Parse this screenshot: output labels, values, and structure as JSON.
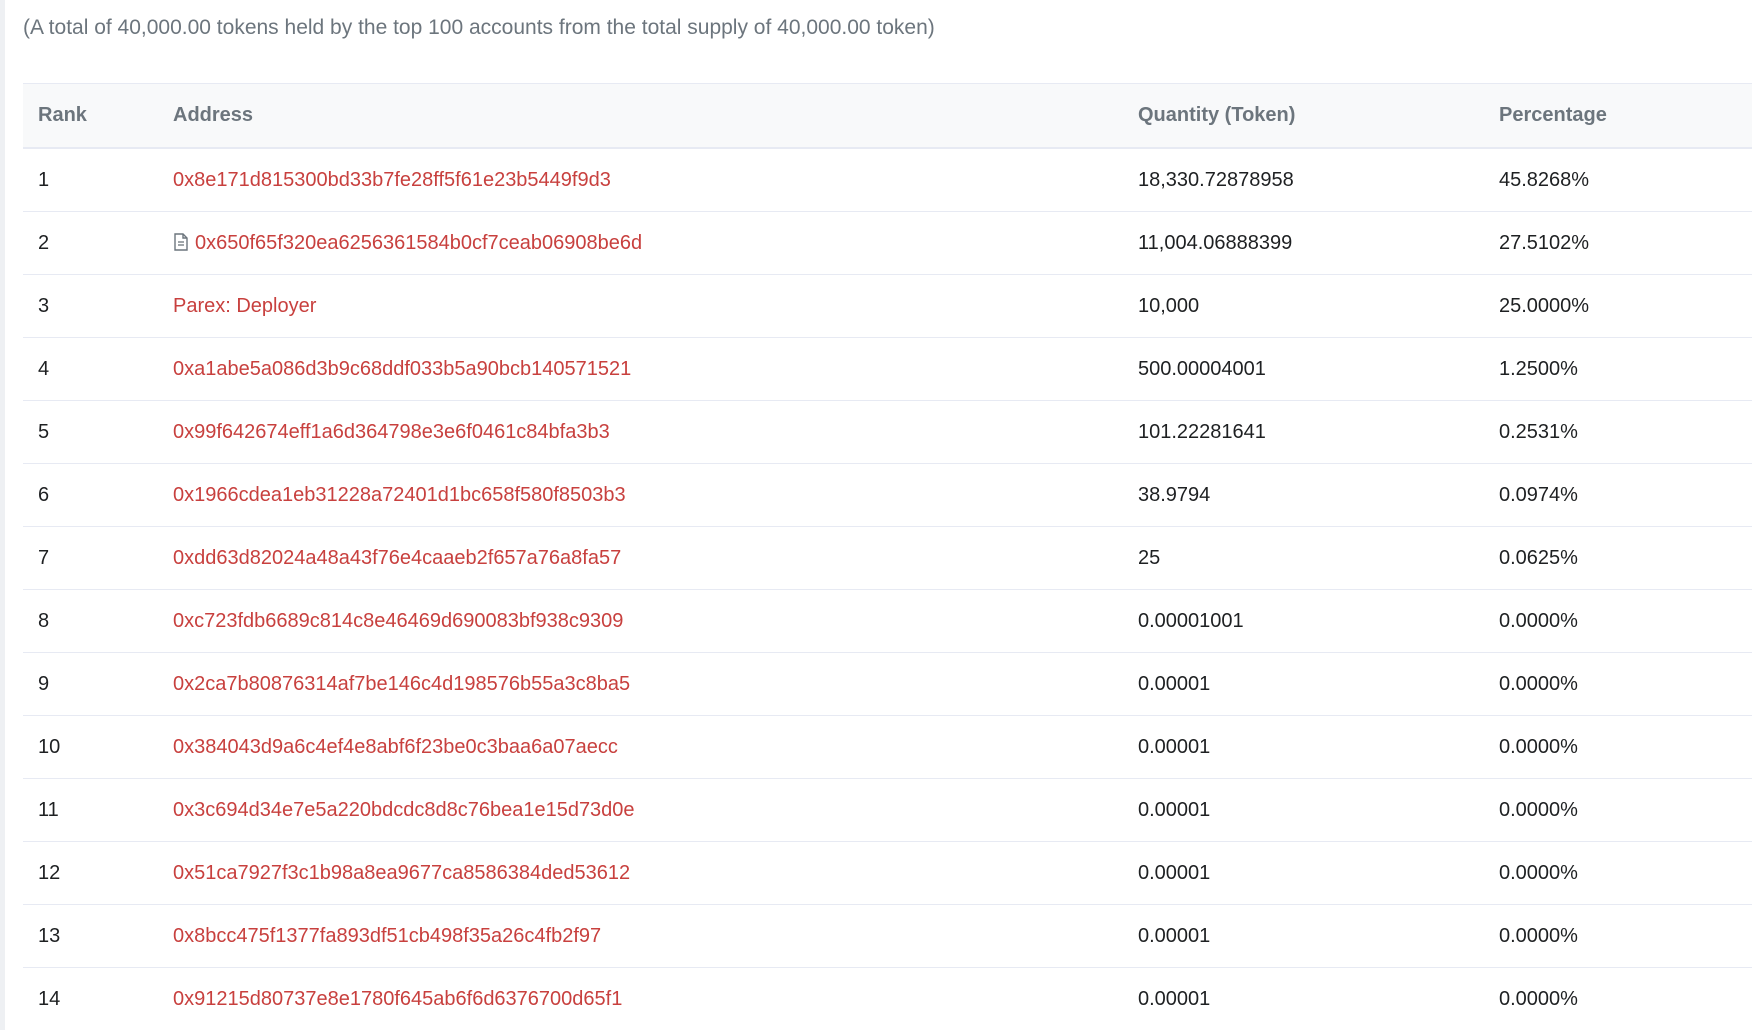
{
  "summary": "(A total of 40,000.00 tokens held by the top 100 accounts from the total supply of 40,000.00 token)",
  "table": {
    "headers": {
      "rank": "Rank",
      "address": "Address",
      "quantity": "Quantity (Token)",
      "percentage": "Percentage"
    },
    "rows": [
      {
        "rank": "1",
        "address": "0x8e171d815300bd33b7fe28ff5f61e23b5449f9d3",
        "quantity": "18,330.72878958",
        "percentage": "45.8268%"
      },
      {
        "rank": "2",
        "address": "0x650f65f320ea6256361584b0cf7ceab06908be6d",
        "quantity": "11,004.06888399",
        "percentage": "27.5102%",
        "icon": "contract-icon"
      },
      {
        "rank": "3",
        "address": "Parex: Deployer",
        "quantity": "10,000",
        "percentage": "25.0000%"
      },
      {
        "rank": "4",
        "address": "0xa1abe5a086d3b9c68ddf033b5a90bcb140571521",
        "quantity": "500.00004001",
        "percentage": "1.2500%"
      },
      {
        "rank": "5",
        "address": "0x99f642674eff1a6d364798e3e6f0461c84bfa3b3",
        "quantity": "101.22281641",
        "percentage": "0.2531%"
      },
      {
        "rank": "6",
        "address": "0x1966cdea1eb31228a72401d1bc658f580f8503b3",
        "quantity": "38.9794",
        "percentage": "0.0974%"
      },
      {
        "rank": "7",
        "address": "0xdd63d82024a48a43f76e4caaeb2f657a76a8fa57",
        "quantity": "25",
        "percentage": "0.0625%"
      },
      {
        "rank": "8",
        "address": "0xc723fdb6689c814c8e46469d690083bf938c9309",
        "quantity": "0.00001001",
        "percentage": "0.0000%"
      },
      {
        "rank": "9",
        "address": "0x2ca7b80876314af7be146c4d198576b55a3c8ba5",
        "quantity": "0.00001",
        "percentage": "0.0000%"
      },
      {
        "rank": "10",
        "address": "0x384043d9a6c4ef4e8abf6f23be0c3baa6a07aecc",
        "quantity": "0.00001",
        "percentage": "0.0000%"
      },
      {
        "rank": "11",
        "address": "0x3c694d34e7e5a220bdcdc8d8c76bea1e15d73d0e",
        "quantity": "0.00001",
        "percentage": "0.0000%"
      },
      {
        "rank": "12",
        "address": "0x51ca7927f3c1b98a8ea9677ca8586384ded53612",
        "quantity": "0.00001",
        "percentage": "0.0000%"
      },
      {
        "rank": "13",
        "address": "0x8bcc475f1377fa893df51cb498f35a26c4fb2f97",
        "quantity": "0.00001",
        "percentage": "0.0000%"
      },
      {
        "rank": "14",
        "address": "0x91215d80737e8e1780f645ab6f6d6376700d65f1",
        "quantity": "0.00001",
        "percentage": "0.0000%"
      }
    ]
  },
  "colors": {
    "link": "#c8403e",
    "header_text": "#6c757d",
    "body_text": "#1e2022",
    "border": "#e7eaf3",
    "header_bg": "#f8f9fa"
  }
}
